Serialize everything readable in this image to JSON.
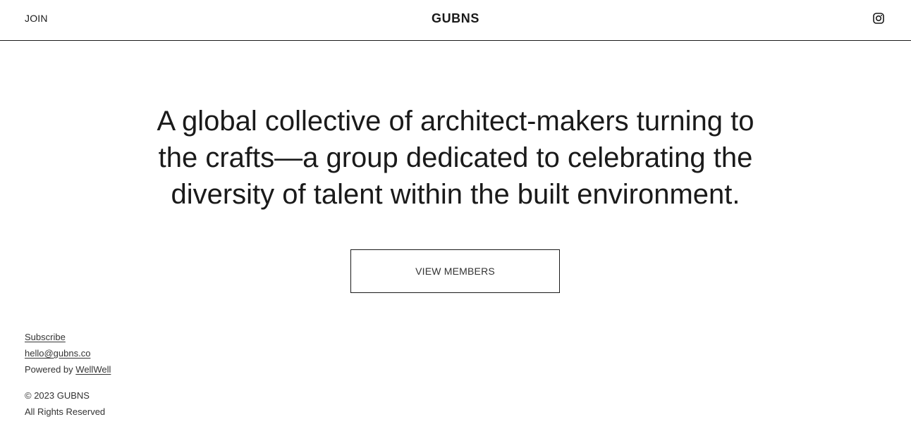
{
  "header": {
    "join_label": "JOIN",
    "site_title": "GUBNS",
    "social_icon": "instagram-icon"
  },
  "hero": {
    "text": "A global collective of architect-makers turning to the crafts—a group dedicated to celebrating the diversity of talent within the built environment.",
    "button_label": "VIEW MEMBERS"
  },
  "footer": {
    "subscribe_label": "Subscribe",
    "email": "hello@gubns.co",
    "powered_prefix": "Powered by",
    "powered_link": "WellWell",
    "copyright": "© 2023 GUBNS",
    "rights": "All Rights Reserved"
  },
  "colors": {
    "text": "#1a1a1a",
    "background": "#ffffff",
    "border": "#1a1a1a"
  }
}
